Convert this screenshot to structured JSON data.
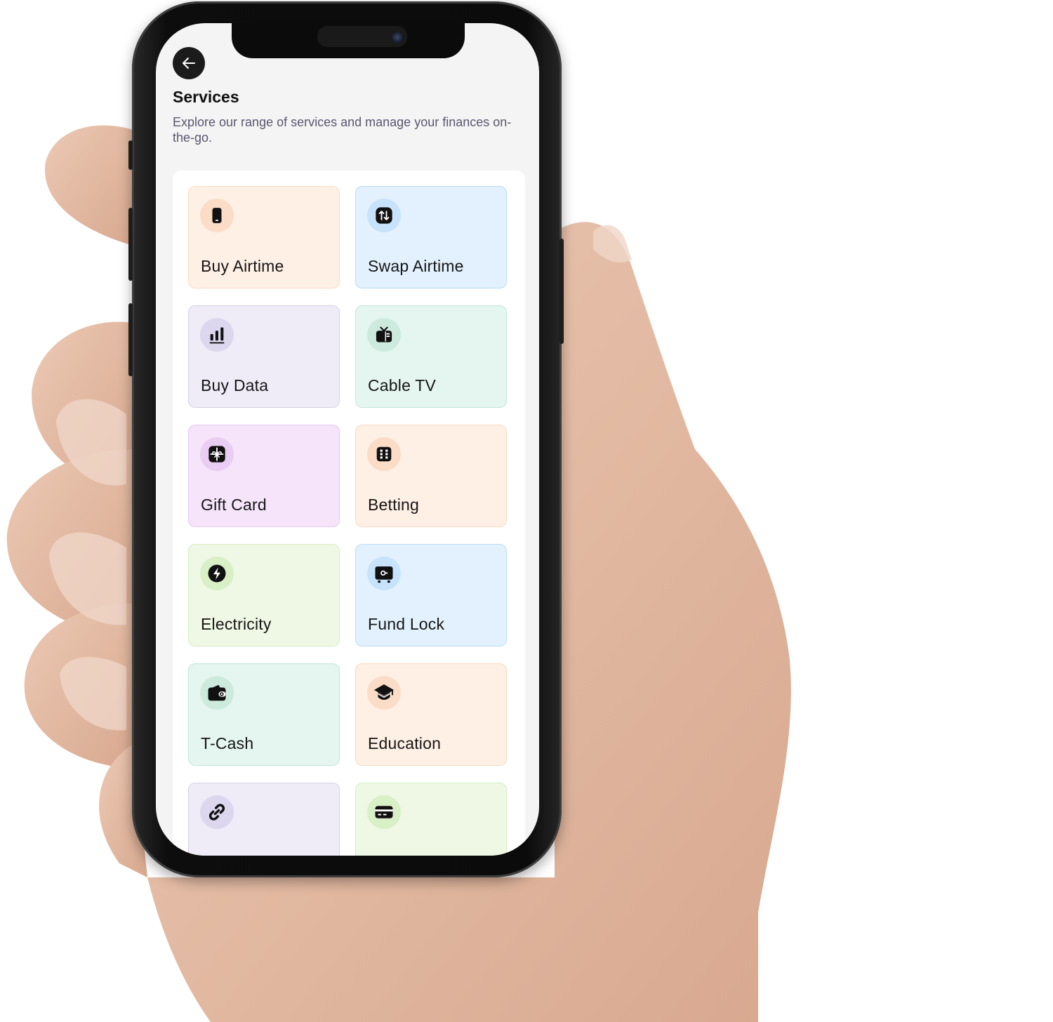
{
  "header": {
    "title": "Services",
    "subtitle": "Explore our range of services and manage your finances on-the-go."
  },
  "services": [
    {
      "label": "Buy Airtime",
      "icon": "phone-icon",
      "bg": "#fff0e5",
      "border": "#fbd9c2",
      "icon_bg": "#fbdcc6"
    },
    {
      "label": "Swap Airtime",
      "icon": "swap-icon",
      "bg": "#e2f1fd",
      "border": "#bcdcf7",
      "icon_bg": "#c7e3fb"
    },
    {
      "label": "Buy Data",
      "icon": "signal-bars-icon",
      "bg": "#efecf7",
      "border": "#d5d0e8",
      "icon_bg": "#dcd7ee"
    },
    {
      "label": "Cable TV",
      "icon": "tv-icon",
      "bg": "#e5f5f0",
      "border": "#c5e6db",
      "icon_bg": "#cdeadf"
    },
    {
      "label": "Gift Card",
      "icon": "gift-icon",
      "bg": "#f5e4fa",
      "border": "#e6c8f1",
      "icon_bg": "#eacdf3"
    },
    {
      "label": "Betting",
      "icon": "dice-icon",
      "bg": "#fff0e5",
      "border": "#fbd9c2",
      "icon_bg": "#fbdcc6"
    },
    {
      "label": "Electricity",
      "icon": "lightning-icon",
      "bg": "#eef8e4",
      "border": "#d6edc2",
      "icon_bg": "#d9efc6"
    },
    {
      "label": "Fund Lock",
      "icon": "safe-icon",
      "bg": "#e2f1fd",
      "border": "#bcdcf7",
      "icon_bg": "#c7e3fb"
    },
    {
      "label": "T-Cash",
      "icon": "wallet-icon",
      "bg": "#e5f5f0",
      "border": "#c5e6db",
      "icon_bg": "#cdeadf"
    },
    {
      "label": "Education",
      "icon": "graduation-cap-icon",
      "bg": "#fff0e5",
      "border": "#fbd9c2",
      "icon_bg": "#fbdcc6"
    },
    {
      "label": "",
      "icon": "link-icon",
      "bg": "#efecf7",
      "border": "#d5d0e8",
      "icon_bg": "#dcd7ee"
    },
    {
      "label": "",
      "icon": "credit-card-icon",
      "bg": "#eef8e4",
      "border": "#d6edc2",
      "icon_bg": "#d9efc6"
    }
  ],
  "icons": {
    "back": "arrow-left-icon"
  }
}
